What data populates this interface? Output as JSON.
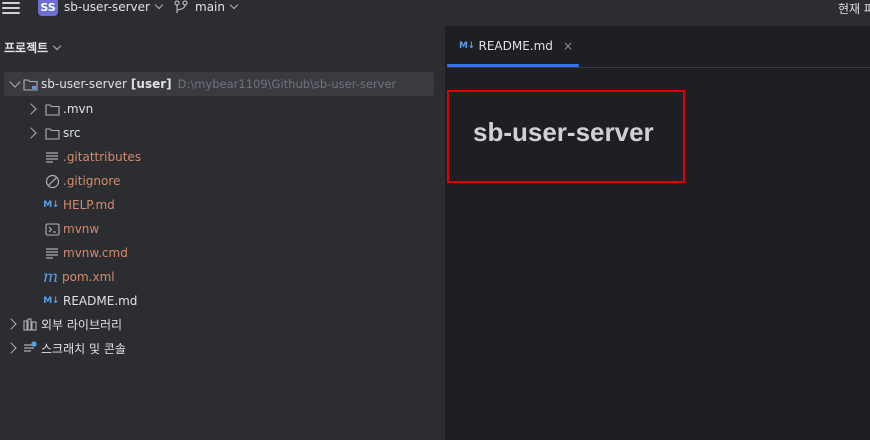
{
  "titlebar": {
    "project_badge": "SS",
    "project_name": "sb-user-server",
    "branch": "main",
    "right_text": "현재 파"
  },
  "panel": {
    "title": "프로젝트"
  },
  "tree": {
    "root": {
      "name": "sb-user-server",
      "module": "[user]",
      "path": "D:\\mybear1109\\Github\\sb-user-server"
    },
    "items": [
      {
        "label": ".mvn",
        "icon": "folder-icon"
      },
      {
        "label": "src",
        "icon": "folder-icon"
      },
      {
        "label": ".gitattributes",
        "icon": "text-file-icon"
      },
      {
        "label": ".gitignore",
        "icon": "ignore-file-icon"
      },
      {
        "label": "HELP.md",
        "icon": "markdown-icon"
      },
      {
        "label": "mvnw",
        "icon": "terminal-icon"
      },
      {
        "label": "mvnw.cmd",
        "icon": "text-file-icon"
      },
      {
        "label": "pom.xml",
        "icon": "maven-icon"
      },
      {
        "label": "README.md",
        "icon": "markdown-icon"
      }
    ],
    "external_libraries": "외부 라이브러리",
    "scratches": "스크래치 및 콘솔"
  },
  "editor": {
    "tab_label": "README.md",
    "tab_close": "×",
    "heading": "sb-user-server"
  },
  "icons": {
    "markdown": "M↓"
  },
  "colors": {
    "accent": "#3574f0",
    "highlight": "#e00000",
    "badge": "#6b6fd6",
    "file_modified": "#d68a6a"
  }
}
